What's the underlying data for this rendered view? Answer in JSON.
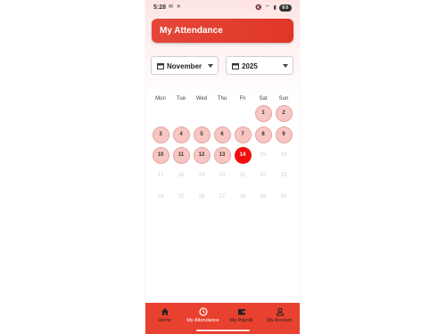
{
  "status_bar": {
    "time": "5:28",
    "left_icons": "✉ ✕",
    "right_icons": "🔇 ⌔ ▮",
    "battery": "60"
  },
  "header": {
    "title": "My Attendance"
  },
  "filters": {
    "month": "November",
    "year": "2025"
  },
  "calendar": {
    "weekdays": [
      "Mon",
      "Tue",
      "Wed",
      "Thu",
      "Fri",
      "Sat",
      "Sun"
    ],
    "days": [
      "1",
      "2",
      "3",
      "4",
      "5",
      "6",
      "7",
      "8",
      "9",
      "10",
      "11",
      "12",
      "13",
      "14",
      "15",
      "16",
      "17",
      "18",
      "19",
      "20",
      "21",
      "22",
      "23",
      "24",
      "25",
      "26",
      "27",
      "28",
      "29",
      "30"
    ],
    "today": "14",
    "first_day_col": 5
  },
  "bottom_nav": {
    "items": [
      {
        "label": "Home",
        "icon": "home-icon"
      },
      {
        "label": "My Attendance",
        "icon": "clock-icon",
        "active": true
      },
      {
        "label": "My Payroll",
        "icon": "wallet-icon"
      },
      {
        "label": "My Account",
        "icon": "person-icon"
      }
    ]
  },
  "colors": {
    "accent": "#e8412f",
    "today": "#f20f0f",
    "past_day_bg": "#f8c6c2",
    "future_text": "#cfcfcf"
  }
}
